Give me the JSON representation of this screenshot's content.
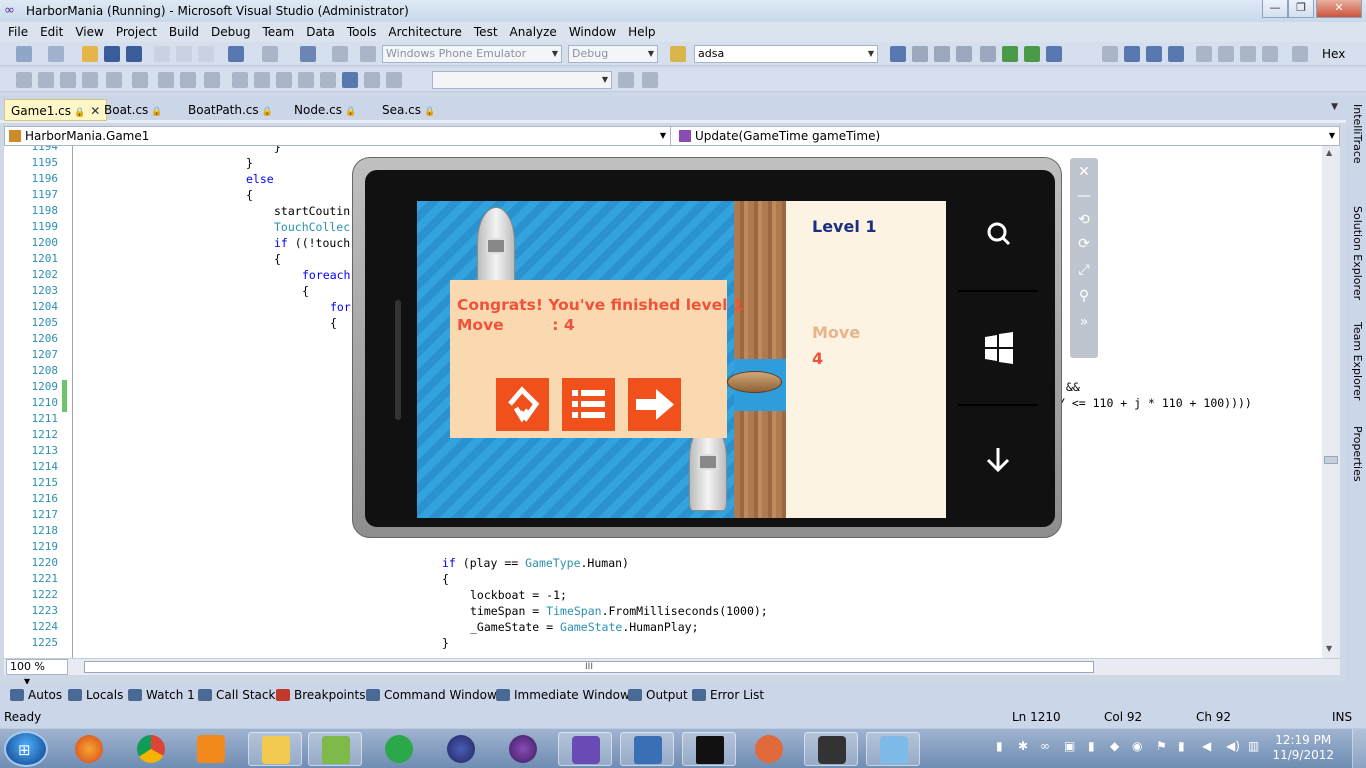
{
  "window": {
    "title": "HarborMania (Running) - Microsoft Visual Studio (Administrator)",
    "controls": [
      "minimize",
      "restore",
      "close"
    ]
  },
  "menu": [
    "File",
    "Edit",
    "View",
    "Project",
    "Build",
    "Debug",
    "Team",
    "Data",
    "Tools",
    "Architecture",
    "Test",
    "Analyze",
    "Window",
    "Help"
  ],
  "toolbar": {
    "target_device": "Windows Phone Emulator",
    "configuration": "Debug",
    "find_value": "adsa",
    "hex_label": "Hex"
  },
  "tabs": [
    {
      "label": "Game1.cs",
      "active": true
    },
    {
      "label": "Boat.cs",
      "active": false
    },
    {
      "label": "BoatPath.cs",
      "active": false
    },
    {
      "label": "Node.cs",
      "active": false
    },
    {
      "label": "Sea.cs",
      "active": false
    }
  ],
  "nav": {
    "type_member": "HarborMania.Game1",
    "method_member": "Update(GameTime gameTime)"
  },
  "editor": {
    "line_numbers": [
      "1194",
      "1195",
      "1196",
      "1197",
      "1198",
      "1199",
      "1200",
      "1201",
      "1202",
      "1203",
      "1204",
      "1205",
      "1206",
      "1207",
      "1208",
      "1209",
      "1210",
      "1211",
      "1212",
      "1213",
      "1214",
      "1215",
      "1216",
      "1217",
      "1218",
      "1219",
      "1220",
      "1221",
      "1222",
      "1223",
      "1224",
      "1225"
    ],
    "zoom": "100 %",
    "hscroll_grip": "III"
  },
  "side_tabs": [
    "IntelliTrace",
    "Solution Explorer",
    "Team Explorer",
    "Properties"
  ],
  "tool_windows": [
    "Autos",
    "Locals",
    "Watch 1",
    "Call Stack",
    "Breakpoints",
    "Command Window",
    "Immediate Window",
    "Output",
    "Error List"
  ],
  "status": {
    "ready": "Ready",
    "line": "Ln 1210",
    "col": "Col 92",
    "ch": "Ch 92",
    "mode": "INS"
  },
  "taskbar": {
    "time": "12:19 PM",
    "date": "11/9/2012"
  },
  "game": {
    "level_label": "Level 1",
    "move_label": "Move",
    "move_value": "4",
    "dialog_title": "Congrats! You've finished level 1",
    "dialog_move": "Move         : 4",
    "buttons": [
      "restart-icon",
      "menu-icon",
      "next-arrow-icon"
    ],
    "accent_color": "#f0501c",
    "dialog_color": "#fad9b0"
  }
}
